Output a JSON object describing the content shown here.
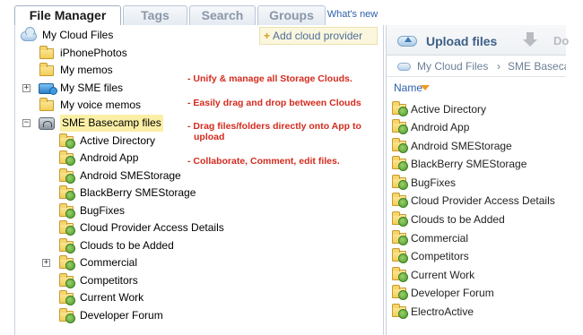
{
  "tabs": [
    {
      "label": "File Manager",
      "active": true
    },
    {
      "label": "Tags",
      "active": false
    },
    {
      "label": "Search",
      "active": false
    },
    {
      "label": "Groups",
      "active": false
    }
  ],
  "whats_new": "What's new",
  "add_cloud_provider": "Add cloud provider",
  "tree": {
    "root": "My Cloud Files",
    "top_items": [
      "iPhonePhotos",
      "My memos",
      "My SME files",
      "My voice memos",
      "SME Basecamp files"
    ],
    "basecamp_children": [
      "Active Directory",
      "Android App",
      "Android SMEStorage",
      "BlackBerry SMEStorage",
      "BugFixes",
      "Cloud Provider Access Details",
      "Clouds to be Added",
      "Commercial",
      "Competitors",
      "Current Work",
      "Developer Forum"
    ]
  },
  "annotations": [
    "- Unify & manage all Storage Clouds.",
    "- Easily drag and drop between Clouds",
    "- Drag files/folders directly onto App to",
    "upload",
    "- Collaborate, Comment, edit files."
  ],
  "right": {
    "upload_label": "Upload files",
    "download_fragment": "Do",
    "breadcrumb_root": "My Cloud Files",
    "breadcrumb_sep": "›",
    "breadcrumb_current": "SME Baseca",
    "column_name": "Name",
    "files": [
      "Active Directory",
      "Android App",
      "Android SMEStorage",
      "BlackBerry SMEStorage",
      "BugFixes",
      "Cloud Provider Access Details",
      "Clouds to be Added",
      "Commercial",
      "Competitors",
      "Current Work",
      "Developer Forum",
      "ElectroActive"
    ]
  },
  "colors": {
    "annotation": "#d42b1e",
    "selected_bg": "#fbefa6",
    "link": "#2e5fa8"
  },
  "icons": [
    "cloud-icon",
    "folder-icon",
    "basecamp-folder-icon",
    "sme-storage-icon",
    "basecamp-icon",
    "expand-plus-icon",
    "collapse-minus-icon",
    "upload-cloud-icon",
    "download-icon",
    "sort-desc-icon"
  ]
}
